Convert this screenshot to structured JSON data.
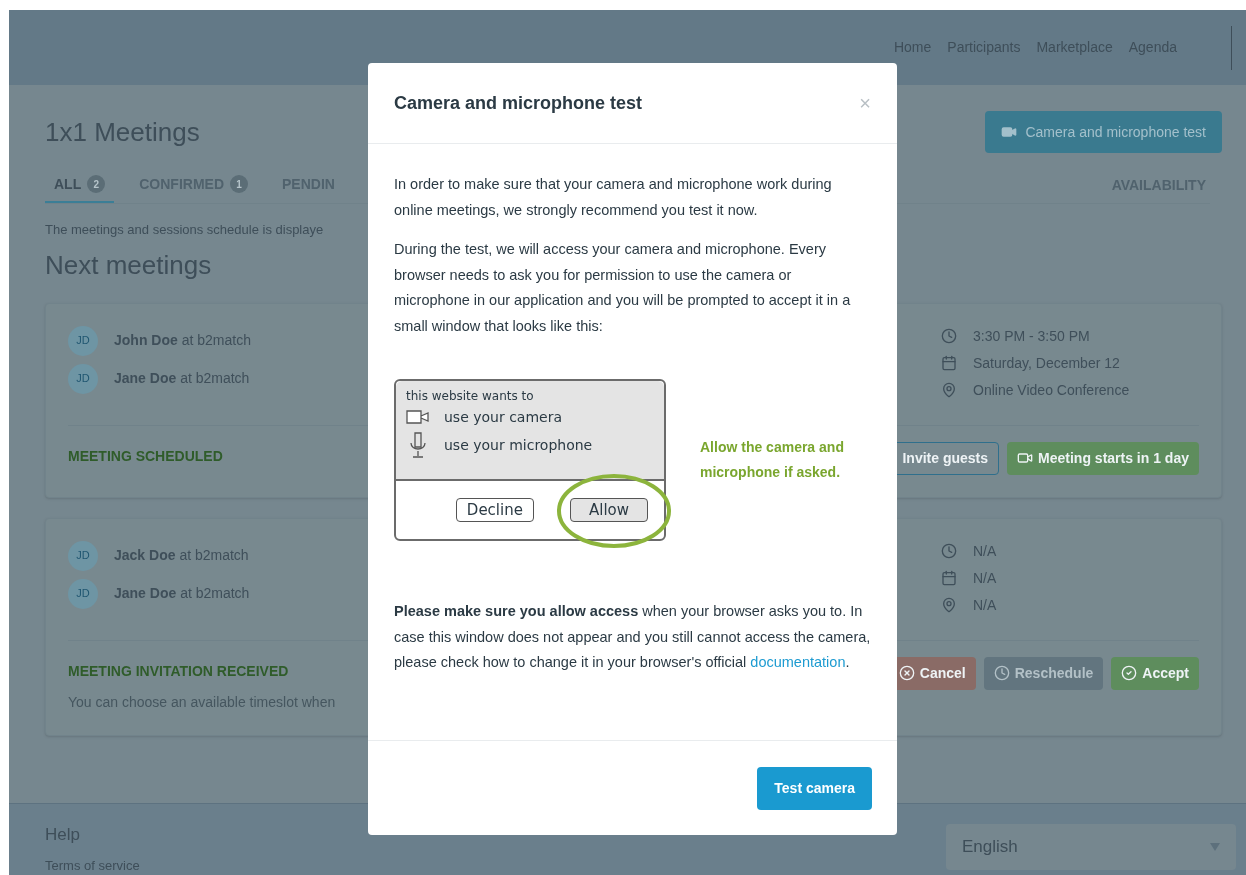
{
  "nav": {
    "links": [
      "Home",
      "Participants",
      "Marketplace",
      "Agenda"
    ]
  },
  "page": {
    "title": "1x1 Meetings",
    "camera_button": "Camera and microphone test",
    "tabs": [
      {
        "label": "ALL",
        "count": "2",
        "selected": true
      },
      {
        "label": "CONFIRMED",
        "count": "1",
        "selected": false
      },
      {
        "label": "PENDIN",
        "selected": false
      }
    ],
    "availability": "AVAILABILITY",
    "notice": "The meetings and sessions schedule is displaye",
    "section_title": "Next meetings"
  },
  "meetings": [
    {
      "participants": [
        {
          "initials": "JD",
          "name": "John Doe",
          "company": "at b2match"
        },
        {
          "initials": "JD",
          "name": "Jane Doe",
          "company": "at b2match"
        }
      ],
      "time": "3:30 PM - 3:50 PM",
      "date": "Saturday, December 12",
      "place": "Online Video Conference",
      "status": "MEETING SCHEDULED",
      "actions": [
        {
          "kind": "outline",
          "label": "Invite guests",
          "disabled": false
        },
        {
          "kind": "start",
          "label": "Meeting starts in 1 day",
          "disabled": false
        }
      ]
    },
    {
      "participants": [
        {
          "initials": "JD",
          "name": "Jack Doe",
          "company": "at b2match"
        },
        {
          "initials": "JD",
          "name": "Jane Doe",
          "company": "at b2match"
        }
      ],
      "time": "N/A",
      "date": "N/A",
      "place": "N/A",
      "status": "MEETING INVITATION RECEIVED",
      "note": "You can choose an available timeslot when",
      "actions": [
        {
          "kind": "cancel",
          "label": "Cancel",
          "disabled": false
        },
        {
          "kind": "reschedule",
          "label": "Reschedule",
          "disabled": true
        },
        {
          "kind": "accept",
          "label": "Accept",
          "disabled": false
        }
      ]
    }
  ],
  "footer": {
    "title": "Help",
    "link": "Terms of service",
    "language": "English"
  },
  "modal": {
    "title": "Camera and microphone test",
    "close": "×",
    "paragraphs": [
      "In order to make sure that your camera and microphone work during online meetings, we strongly recommend you test it now.",
      "During the test, we will access your camera and microphone. Every browser needs to ask you for permission to use the camera or microphone in our application and you will be prompted to accept it in a small window that looks like this:"
    ],
    "illustration": {
      "heading": "this website wants to",
      "camera": "use your camera",
      "microphone": "use your microphone",
      "decline": "Decline",
      "allow": "Allow"
    },
    "caption": "Allow the camera and microphone if asked.",
    "help": {
      "text": "**Please make sure you allow access** when your browser asks you to. In case this window does not appear and you still cannot access the camera, please check how to change it in your browser's official",
      "link": "documentation",
      "after": "."
    },
    "button": "Test camera"
  }
}
